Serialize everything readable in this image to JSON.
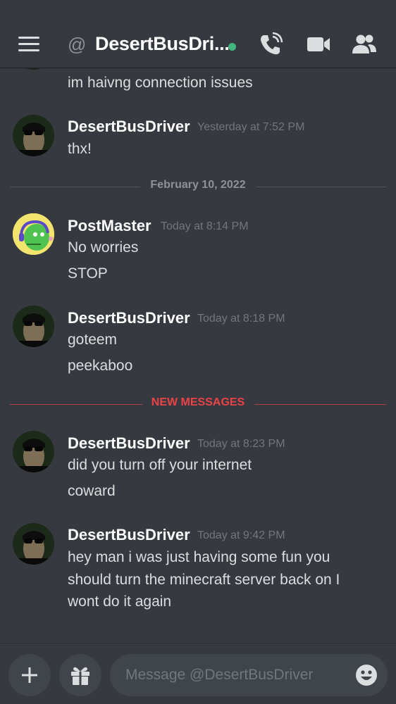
{
  "header": {
    "menu_icon": "hamburger-icon",
    "at_symbol": "@",
    "title": "DesertBusDri...",
    "status_color": "#43b581",
    "icons": [
      "call-icon",
      "video-icon",
      "members-icon"
    ]
  },
  "messages": {
    "partial_text": "im haivng connection issues",
    "group1": {
      "author": "DesertBusDriver",
      "time": "Yesterday at 7:52 PM",
      "lines": [
        "thx!"
      ]
    },
    "divider_date": "February 10, 2022",
    "group2": {
      "author": "PostMaster",
      "time": "Today at 8:14 PM",
      "lines": [
        "No worries",
        "STOP"
      ]
    },
    "group3": {
      "author": "DesertBusDriver",
      "time": "Today at 8:18 PM",
      "lines": [
        "goteem",
        "peekaboo"
      ]
    },
    "divider_new": "NEW MESSAGES",
    "group4": {
      "author": "DesertBusDriver",
      "time": "Today at 8:23 PM",
      "lines": [
        "did you turn off your internet",
        "coward"
      ]
    },
    "group5": {
      "author": "DesertBusDriver",
      "time": "Today at 9:42 PM",
      "lines": [
        "hey man i was just having some fun you",
        "should turn the minecraft server back on I",
        "wont do it again"
      ]
    }
  },
  "composer": {
    "add_icon": "plus-icon",
    "gift_icon": "gift-icon",
    "placeholder": "Message @DesertBusDriver",
    "emoji_icon": "emoji-icon"
  },
  "colors": {
    "background": "#36393f",
    "new_messages": "#ed4245",
    "online": "#43b581"
  }
}
